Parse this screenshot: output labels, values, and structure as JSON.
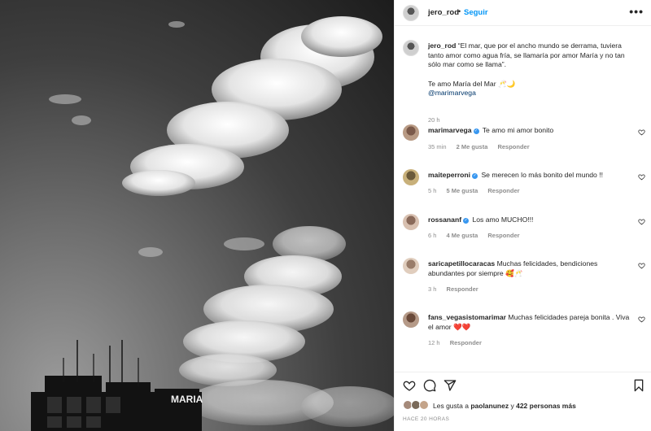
{
  "post": {
    "author": "jero_rod",
    "follow_label": "Seguir",
    "dot": "•",
    "more_label": "•••",
    "image_sign_text": "MARIA",
    "caption": {
      "username": "jero_rod",
      "text": "“El mar, que por el ancho mundo se derrama, tuviera tanto amor como agua fría, se llamaría por amor María y no tan sólo mar como se llama”.",
      "line2": "Te amo María del Mar 🥂🌙",
      "mention": "@marimarvega",
      "time": "20 h"
    }
  },
  "comments": [
    {
      "username": "marimarvega",
      "verified": true,
      "text": "Te amo mi amor bonito",
      "time": "35 min",
      "likes": "2 Me gusta",
      "reply": "Responder"
    },
    {
      "username": "maiteperroni",
      "verified": true,
      "text": "Se merecen lo más bonito del mundo !!",
      "time": "5 h",
      "likes": "5 Me gusta",
      "reply": "Responder"
    },
    {
      "username": "rossananf",
      "verified": true,
      "text": "Los amo MUCHO!!!",
      "time": "6 h",
      "likes": "4 Me gusta",
      "reply": "Responder"
    },
    {
      "username": "saricapetillocaracas",
      "verified": false,
      "text": "Muchas felicidades, bendiciones abundantes por siempre 🥰🥂",
      "time": "3 h",
      "likes": "",
      "reply": "Responder"
    },
    {
      "username": "fans_vegasistomarimar",
      "verified": false,
      "text": "Muchas felicidades pareja bonita . Viva el amor ❤️❤️",
      "time": "12 h",
      "likes": "",
      "reply": "Responder"
    }
  ],
  "footer": {
    "likes_prefix": "Les gusta a",
    "likes_user": "paolanunez",
    "likes_middle": "y",
    "likes_count": "422 personas más",
    "time_ago": "HACE 20 HORAS"
  },
  "colors": {
    "accent": "#0095f6",
    "verified": "#3897f0",
    "heart": "#ed4956"
  }
}
